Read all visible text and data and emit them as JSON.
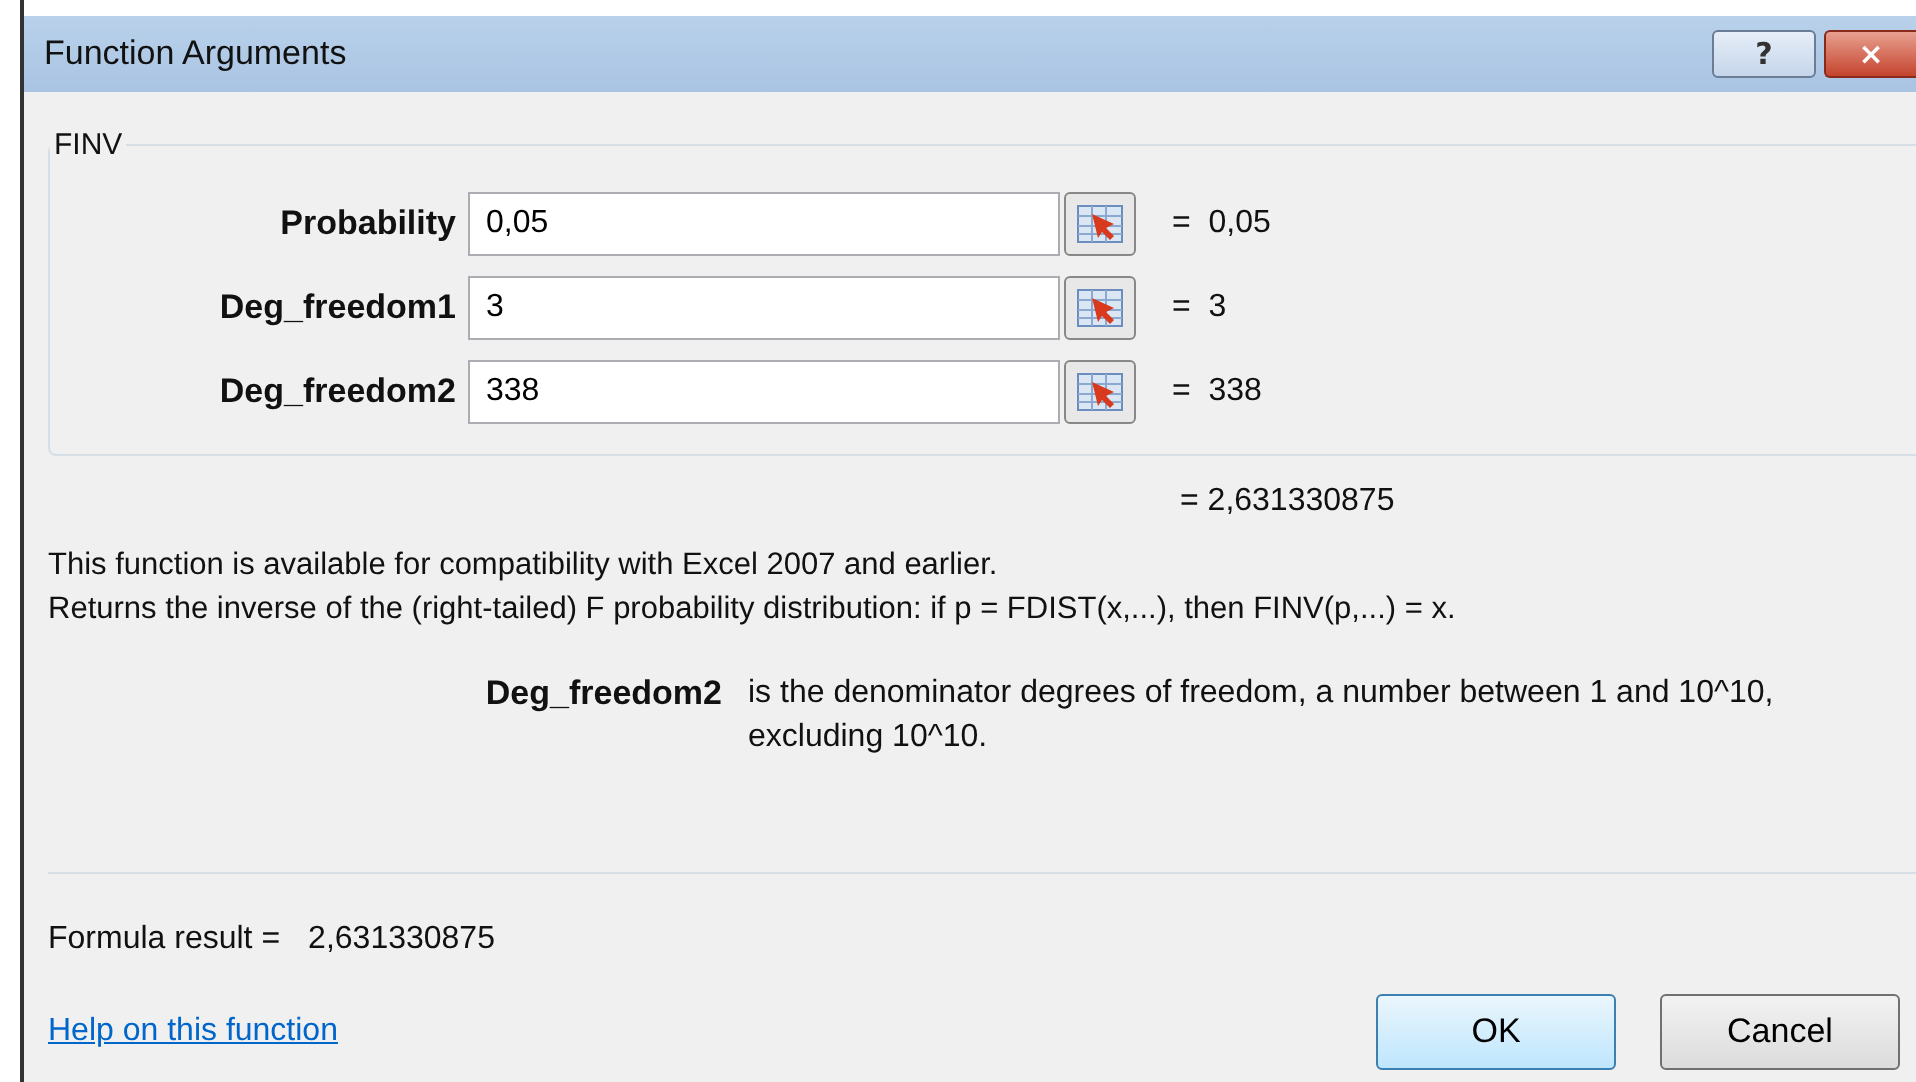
{
  "window": {
    "title": "Function Arguments",
    "buttons": [
      "?",
      "×"
    ]
  },
  "function": {
    "name": "FINV",
    "arguments": [
      {
        "label": "Probability",
        "value": "0,05",
        "result": "=  0,05"
      },
      {
        "label": "Deg_freedom1",
        "value": "3",
        "result": "=  3"
      },
      {
        "label": "Deg_freedom2",
        "value": "338",
        "result": "=  338"
      }
    ],
    "result": "= 2,631330875"
  },
  "description": [
    "This function is available for compatibility with Excel 2007 and earlier.",
    "Returns the inverse of the (right-tailed) F probability distribution: if p = FDIST(x,...), then FINV(p,...) = x."
  ],
  "argument_help": {
    "name": "Deg_freedom2",
    "text": "is the denominator degrees of freedom, a number between 1 and 10^10, excluding 10^10."
  },
  "formula_result": {
    "label": "Formula result =",
    "value": "2,631330875"
  },
  "help_link": "Help on this function",
  "buttons": [
    "OK",
    "Cancel"
  ]
}
